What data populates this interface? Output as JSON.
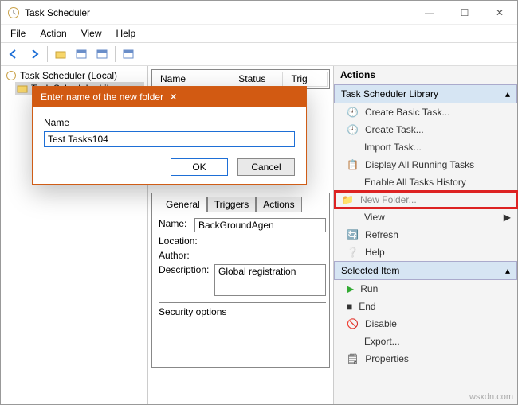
{
  "window": {
    "title": "Task Scheduler"
  },
  "menu": {
    "file": "File",
    "action": "Action",
    "view": "View",
    "help": "Help"
  },
  "tree": {
    "root": "Task Scheduler (Local)",
    "child": "Task Scheduler Library"
  },
  "grid": {
    "cols": {
      "name": "Name",
      "status": "Status",
      "trig": "Trig"
    }
  },
  "details": {
    "tabs": {
      "general": "General",
      "triggers": "Triggers",
      "actions": "Actions"
    },
    "labels": {
      "name": "Name:",
      "location": "Location:",
      "author": "Author:",
      "description": "Description:",
      "security": "Security options"
    },
    "values": {
      "name": "BackGroundAgen",
      "location": "",
      "author": "",
      "description": "Global registration"
    }
  },
  "actions_pane": {
    "header": "Actions",
    "section1": "Task Scheduler Library",
    "items1": {
      "create_basic": "Create Basic Task...",
      "create_task": "Create Task...",
      "import": "Import Task...",
      "running": "Display All Running Tasks",
      "history": "Enable All Tasks History",
      "new_folder": "New Folder...",
      "view": "View",
      "refresh": "Refresh",
      "help": "Help"
    },
    "section2": "Selected Item",
    "items2": {
      "run": "Run",
      "end": "End",
      "disable": "Disable",
      "export": "Export...",
      "properties": "Properties"
    }
  },
  "modal": {
    "title": "Enter name of the new folder",
    "label": "Name",
    "value": "Test Tasks104",
    "ok": "OK",
    "cancel": "Cancel"
  },
  "watermark": "wsxdn.com"
}
